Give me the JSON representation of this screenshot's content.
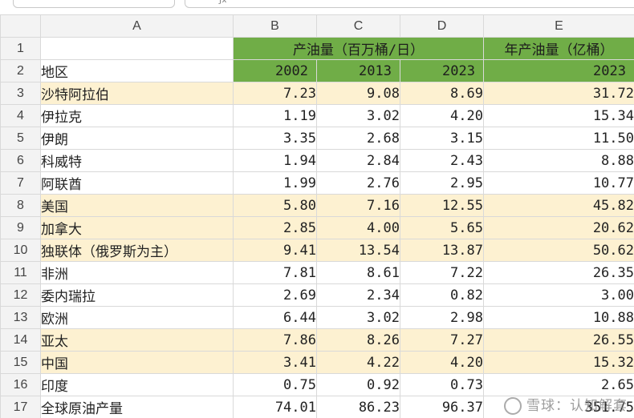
{
  "columns": [
    "A",
    "B",
    "C",
    "D",
    "E"
  ],
  "header_row1": {
    "rownum": "1",
    "merged_bcd": "产油量（百万桶/日）",
    "e": "年产油量（亿桶）"
  },
  "header_row2": {
    "rownum": "2",
    "a": "地区",
    "b": "2002",
    "c": "2013",
    "d": "2023",
    "e": "2023"
  },
  "rows": [
    {
      "rownum": "3",
      "region": "沙特阿拉伯",
      "b": "7.23",
      "c": "9.08",
      "d": "8.69",
      "e": "31.72"
    },
    {
      "rownum": "4",
      "region": "伊拉克",
      "b": "1.19",
      "c": "3.02",
      "d": "4.20",
      "e": "15.34"
    },
    {
      "rownum": "5",
      "region": "伊朗",
      "b": "3.35",
      "c": "2.68",
      "d": "3.15",
      "e": "11.50"
    },
    {
      "rownum": "6",
      "region": "科威特",
      "b": "1.94",
      "c": "2.84",
      "d": "2.43",
      "e": "8.88"
    },
    {
      "rownum": "7",
      "region": "阿联酋",
      "b": "1.99",
      "c": "2.76",
      "d": "2.95",
      "e": "10.77"
    },
    {
      "rownum": "8",
      "region": "美国",
      "b": "5.80",
      "c": "7.16",
      "d": "12.55",
      "e": "45.82"
    },
    {
      "rownum": "9",
      "region": "加拿大",
      "b": "2.85",
      "c": "4.00",
      "d": "5.65",
      "e": "20.62"
    },
    {
      "rownum": "10",
      "region": "独联体（俄罗斯为主）",
      "b": "9.41",
      "c": "13.54",
      "d": "13.87",
      "e": "50.62"
    },
    {
      "rownum": "11",
      "region": "非洲",
      "b": "7.81",
      "c": "8.61",
      "d": "7.22",
      "e": "26.35"
    },
    {
      "rownum": "12",
      "region": "委内瑞拉",
      "b": "2.69",
      "c": "2.34",
      "d": "0.82",
      "e": "3.00"
    },
    {
      "rownum": "13",
      "region": "欧洲",
      "b": "6.44",
      "c": "3.02",
      "d": "2.98",
      "e": "10.88"
    },
    {
      "rownum": "14",
      "region": "亚太",
      "b": "7.86",
      "c": "8.26",
      "d": "7.27",
      "e": "26.55"
    },
    {
      "rownum": "15",
      "region": "中国",
      "b": "3.41",
      "c": "4.22",
      "d": "4.20",
      "e": "15.32"
    },
    {
      "rownum": "16",
      "region": "印度",
      "b": "0.75",
      "c": "0.92",
      "d": "0.73",
      "e": "2.65"
    },
    {
      "rownum": "17",
      "region": "全球原油产量",
      "b": "74.01",
      "c": "86.23",
      "d": "96.37",
      "e": "351.75"
    }
  ],
  "highlight_color": "#fdf1d1",
  "header_green": "#70ad47",
  "watermark": "雪球：认知解套",
  "formula_bar_text": "ƒx"
}
